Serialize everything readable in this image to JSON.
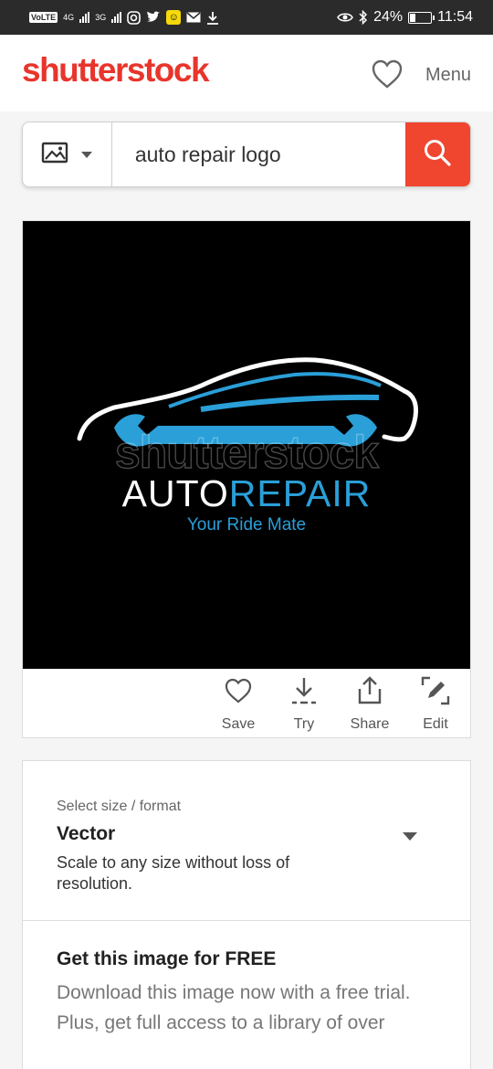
{
  "status_bar": {
    "volte": "VoLTE",
    "net1": "4G",
    "net2": "3G",
    "battery": "24%",
    "battery_level": 0.24,
    "time": "11:54"
  },
  "header": {
    "logo": "shutterstock",
    "menu_label": "Menu"
  },
  "search": {
    "type_icon": "image-icon",
    "query": "auto repair logo",
    "button_icon": "search-icon"
  },
  "image": {
    "watermark": "shutterstock",
    "brand_main": "AUTO",
    "brand_accent": "REPAIR",
    "tagline": "Your Ride Mate",
    "accent_color": "#2a9fd8"
  },
  "actions": [
    {
      "label": "Save",
      "icon": "heart-icon"
    },
    {
      "label": "Try",
      "icon": "download-icon"
    },
    {
      "label": "Share",
      "icon": "share-icon"
    },
    {
      "label": "Edit",
      "icon": "edit-icon"
    }
  ],
  "size_panel": {
    "label": "Select size / format",
    "value": "Vector",
    "description": "Scale to any size without loss of resolution."
  },
  "free_panel": {
    "title": "Get this image for FREE",
    "description": "Download this image now with a free trial. Plus, get full access to a library of over"
  },
  "colors": {
    "brand_red": "#e8352c",
    "search_button": "#f0452f"
  }
}
